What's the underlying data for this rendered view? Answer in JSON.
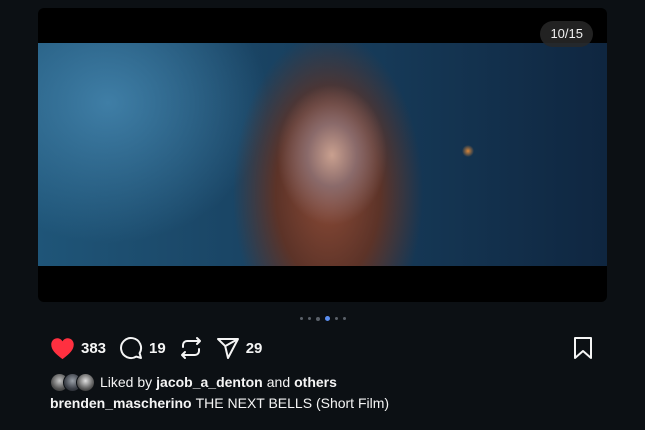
{
  "post": {
    "image_counter": "10/15",
    "carousel": {
      "total_dots": 6,
      "active_index": 3
    }
  },
  "actions": {
    "like_count": "383",
    "comment_count": "19",
    "repost_count": "",
    "share_count": "29",
    "liked": true,
    "like_color": "#ff3040"
  },
  "likes": {
    "prefix": "Liked by",
    "user": "jacob_a_denton",
    "connector": "and",
    "others": "others"
  },
  "caption": {
    "username": "brenden_mascherino",
    "text": "THE NEXT BELLS (Short Film)"
  },
  "icons": [
    "heart-icon",
    "comment-icon",
    "repost-icon",
    "share-icon",
    "bookmark-icon"
  ]
}
